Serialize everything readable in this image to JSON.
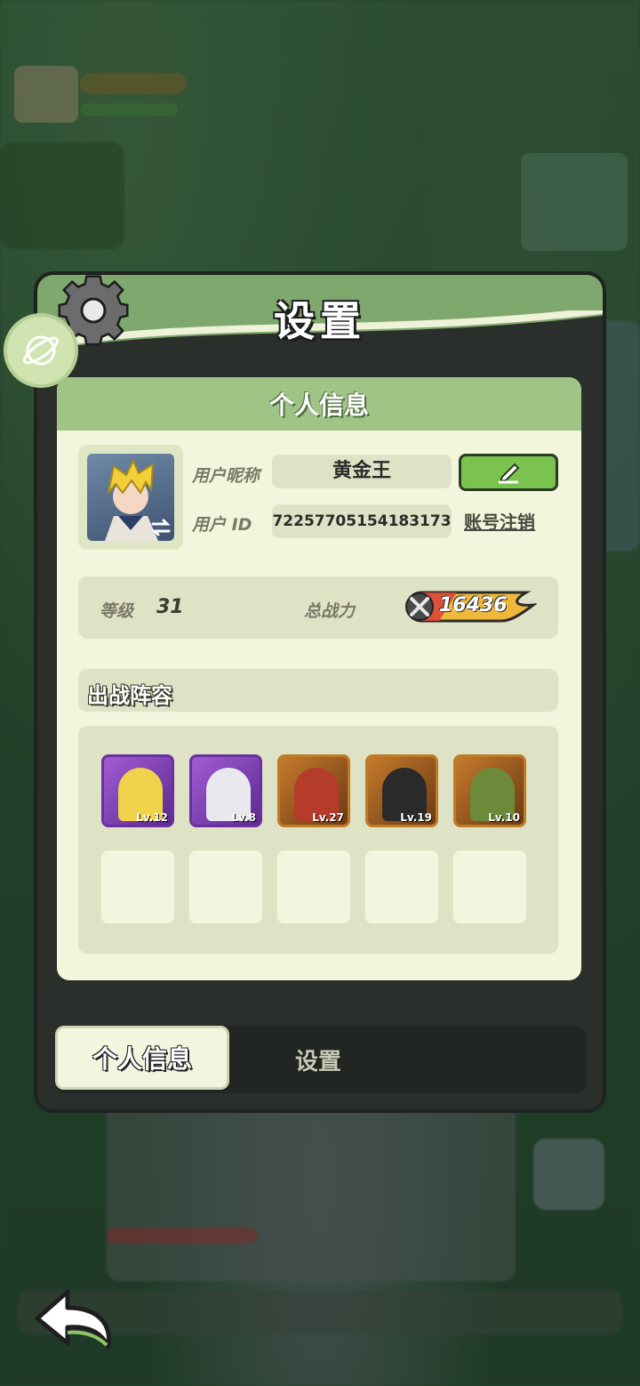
{
  "panel": {
    "title": "设置"
  },
  "profile": {
    "section_title": "个人信息",
    "nickname_label": "用户昵称",
    "nickname": "黄金王",
    "id_label": "用户 ID",
    "user_id": "72257705154183173",
    "delete_account": "账号注销"
  },
  "stats": {
    "level_label": "等级",
    "level": "31",
    "power_label": "总战力",
    "power": "16436"
  },
  "lineup": {
    "title": "出战阵容",
    "heroes": [
      {
        "level": "Lv.12",
        "rarity": "purple"
      },
      {
        "level": "Lv.8",
        "rarity": "purple"
      },
      {
        "level": "Lv.27",
        "rarity": "orange"
      },
      {
        "level": "Lv.19",
        "rarity": "orange"
      },
      {
        "level": "Lv.10",
        "rarity": "orange"
      }
    ]
  },
  "tabs": [
    {
      "label": "个人信息",
      "active": true
    },
    {
      "label": "设置",
      "active": false
    }
  ],
  "colors": {
    "accent": "#79c34e",
    "header": "#7ea86e",
    "card": "#f2f6dc"
  }
}
